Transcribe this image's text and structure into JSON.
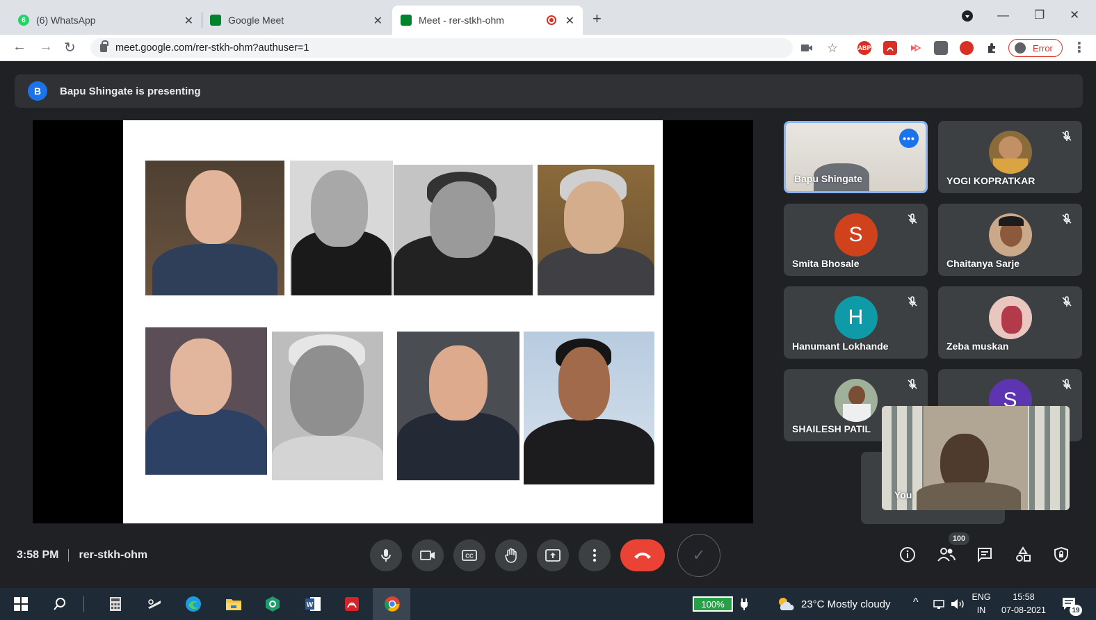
{
  "browser": {
    "tabs": [
      {
        "title": "(6) WhatsApp",
        "badge": "6"
      },
      {
        "title": "Google Meet"
      },
      {
        "title": "Meet - rer-stkh-ohm",
        "recording": true
      }
    ],
    "url": "meet.google.com/rer-stkh-ohm?authuser=1",
    "profile_status": "Error",
    "extensions": [
      "camera-icon",
      "star-icon",
      "adblock-icon",
      "pdf-icon",
      "cast-icon",
      "puzzle-ext-icon",
      "tomato-icon",
      "extensions-icon"
    ],
    "ext_labels": {
      "adblock": "ABP"
    }
  },
  "meet": {
    "presenter_avatar": "B",
    "presenting_text": "Bapu Shingate is presenting",
    "participants": [
      {
        "name": "Bapu Shingate",
        "type": "video",
        "speaking": true
      },
      {
        "name": "YOGI KOPRATKAR",
        "type": "photo"
      },
      {
        "name": "Smita Bhosale",
        "type": "letter",
        "letter": "S",
        "color": "#d0421b"
      },
      {
        "name": "Chaitanya Sarje",
        "type": "photo"
      },
      {
        "name": "Hanumant Lokhande",
        "type": "letter",
        "letter": "H",
        "color": "#0e9aa7"
      },
      {
        "name": "Zeba muskan",
        "type": "photo"
      },
      {
        "name": "SHAILESH PATIL",
        "type": "photo"
      },
      {
        "name": "",
        "type": "letter",
        "letter": "S",
        "color": "#5e35b1"
      }
    ],
    "self_label": "You",
    "time": "3:58 PM",
    "meeting_code": "rer-stkh-ohm",
    "participant_count": "100"
  },
  "taskbar": {
    "battery": "100%",
    "weather": "23°C  Mostly cloudy",
    "lang_top": "ENG",
    "lang_bottom": "IN",
    "clock_time": "15:58",
    "clock_date": "07-08-2021",
    "notifications": "19"
  },
  "colors": {
    "meet_bg": "#202124",
    "accent_blue": "#1a73e8",
    "end_call_red": "#ea4335",
    "taskbar_bg": "#1f2a37"
  }
}
